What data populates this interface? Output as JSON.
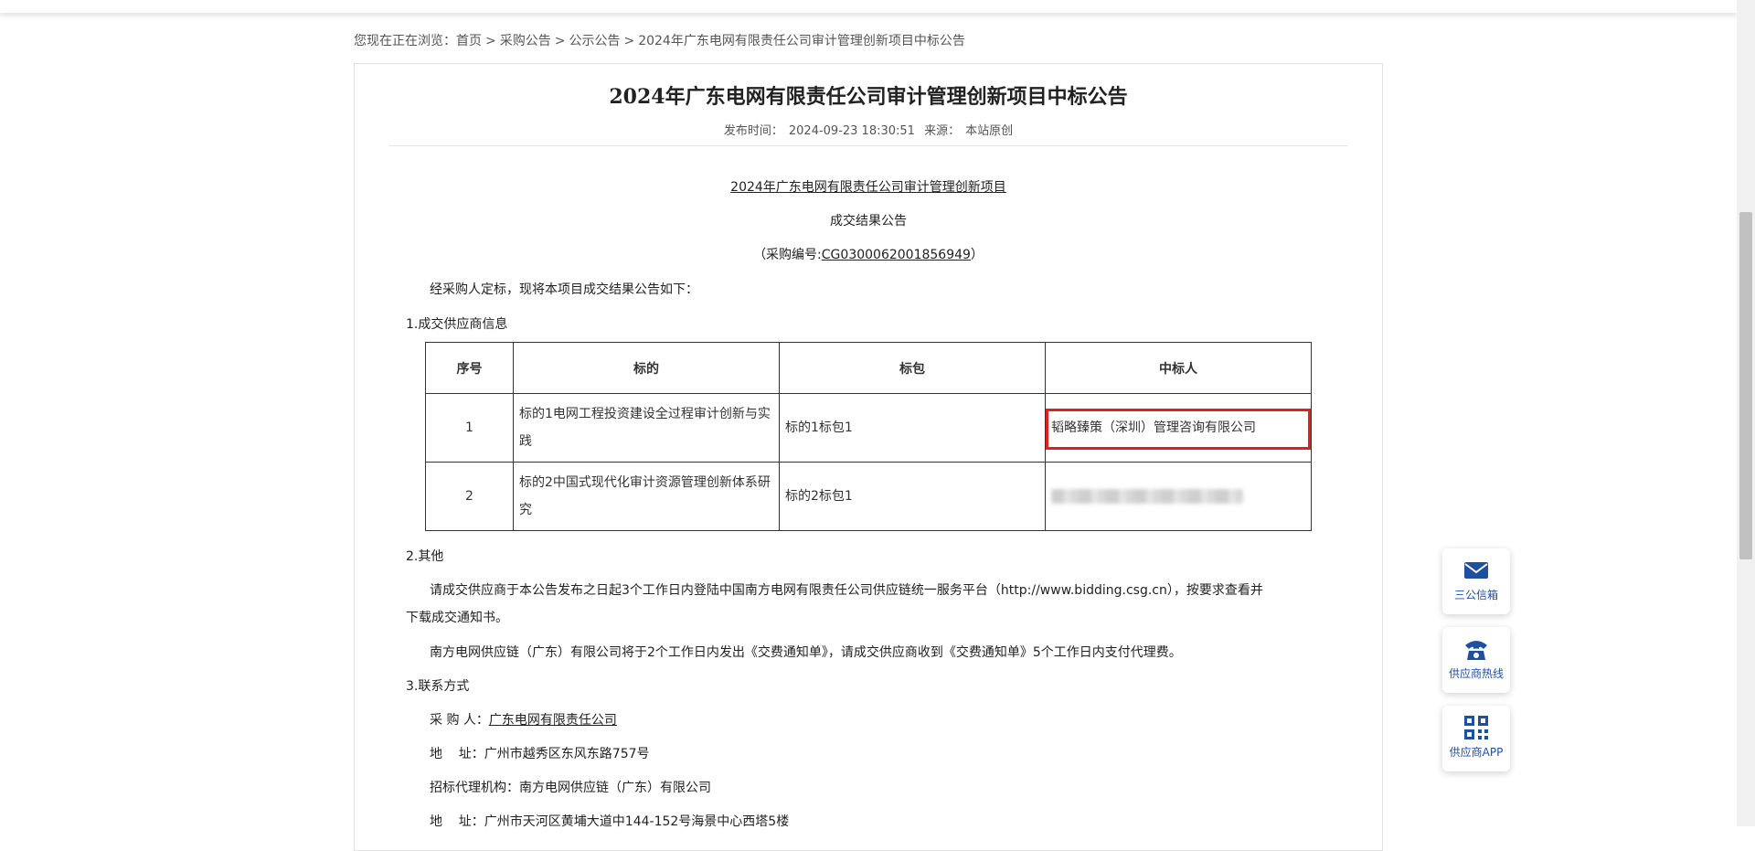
{
  "breadcrumb": {
    "prefix": "您现在正在浏览：",
    "items": [
      "首页",
      "采购公告",
      "公示公告",
      "2024年广东电网有限责任公司审计管理创新项目中标公告"
    ],
    "separator": ">"
  },
  "article": {
    "title": "2024年广东电网有限责任公司审计管理创新项目中标公告",
    "publish_label": "发布时间：",
    "publish_time": "2024-09-23 18:30:51",
    "source_label": "来源：",
    "source": "本站原创"
  },
  "body": {
    "project_name": "2024年广东电网有限责任公司审计管理创新项目",
    "notice_type": "成交结果公告",
    "proc_prefix": "（采购编号:",
    "proc_no": "CG0300062001856949",
    "proc_suffix": "）",
    "intro": "经采购人定标，现将本项目成交结果公告如下：",
    "section1": "1.成交供应商信息",
    "table": {
      "headers": [
        "序号",
        "标的",
        "标包",
        "中标人"
      ],
      "rows": [
        {
          "idx": "1",
          "target": "标的1电网工程投资建设全过程审计创新与实践",
          "package": "标的1标包1",
          "winner": "韬略臻策（深圳）管理咨询有限公司"
        },
        {
          "idx": "2",
          "target": "标的2中国式现代化审计资源管理创新体系研究",
          "package": "标的2标包1",
          "winner": ""
        }
      ]
    },
    "section2": "2.其他",
    "other_p1_line1": "请成交供应商于本公告发布之日起3个工作日内登陆中国南方电网有限责任公司供应链统一服务平台（http://www.bidding.csg.cn），按要求查看并",
    "other_p1_line2": "下载成交通知书。",
    "other_p2": "南方电网供应链（广东）有限公司将于2个工作日内发出《交费通知单》，请成交供应商收到《交费通知单》5个工作日内支付代理费。",
    "section3": "3.联系方式",
    "purchaser_label": "采 购 人：",
    "purchaser": "广东电网有限责任公司",
    "addr1": "地    址：广州市越秀区东风东路757号",
    "agency": "招标代理机构：南方电网供应链（广东）有限公司",
    "addr2": "地    址：广州市天河区黄埔大道中144-152号海景中心西塔5楼"
  },
  "float_buttons": [
    {
      "label": "三公信箱",
      "icon": "mail-icon"
    },
    {
      "label": "供应商热线",
      "icon": "phone-icon"
    },
    {
      "label": "供应商APP",
      "icon": "qr-code-icon"
    }
  ],
  "colors": {
    "accent": "#1e50a0",
    "highlight": "#e02020"
  }
}
